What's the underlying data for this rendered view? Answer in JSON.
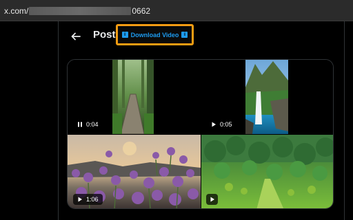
{
  "browser": {
    "url_prefix": "x.com/",
    "url_suffix": "0662"
  },
  "header": {
    "back_icon": "arrow-left-icon",
    "title": "Post",
    "download_button_label": "Download Video",
    "highlight_color": "#f39c12",
    "accent_color": "#1d9bf0"
  },
  "media": [
    {
      "icon": "pause-icon",
      "duration": "0:04"
    },
    {
      "icon": "play-icon",
      "duration": "0:05"
    },
    {
      "icon": "play-icon",
      "duration": "1:06"
    },
    {
      "icon": "play-icon",
      "duration": ""
    }
  ]
}
